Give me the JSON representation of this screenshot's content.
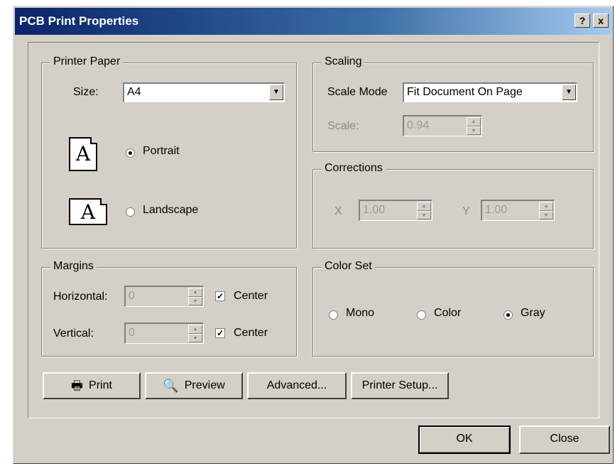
{
  "window": {
    "title": "PCB Print Properties",
    "help_button": "?",
    "close_button": "x"
  },
  "printer_paper": {
    "group_label": "Printer Paper",
    "size_label": "Size:",
    "size_value": "A4",
    "portrait_label": "Portrait",
    "landscape_label": "Landscape",
    "orientation_selected": "Portrait",
    "icon_letter": "A"
  },
  "scaling": {
    "group_label": "Scaling",
    "scale_mode_label": "Scale Mode",
    "scale_mode_value": "Fit Document On Page",
    "scale_label": "Scale:",
    "scale_value": "0.94"
  },
  "corrections": {
    "group_label": "Corrections",
    "x_label": "X",
    "x_value": "1.00",
    "y_label": "Y",
    "y_value": "1.00"
  },
  "margins": {
    "group_label": "Margins",
    "horizontal_label": "Horizontal:",
    "horizontal_value": "0",
    "horizontal_center_label": "Center",
    "horizontal_center_checked": true,
    "vertical_label": "Vertical:",
    "vertical_value": "0",
    "vertical_center_label": "Center",
    "vertical_center_checked": true
  },
  "color_set": {
    "group_label": "Color Set",
    "mono_label": "Mono",
    "color_label": "Color",
    "gray_label": "Gray",
    "selected": "Gray"
  },
  "buttons": {
    "print": "Print",
    "preview": "Preview",
    "advanced": "Advanced...",
    "printer_setup": "Printer Setup...",
    "ok": "OK",
    "close": "Close"
  }
}
